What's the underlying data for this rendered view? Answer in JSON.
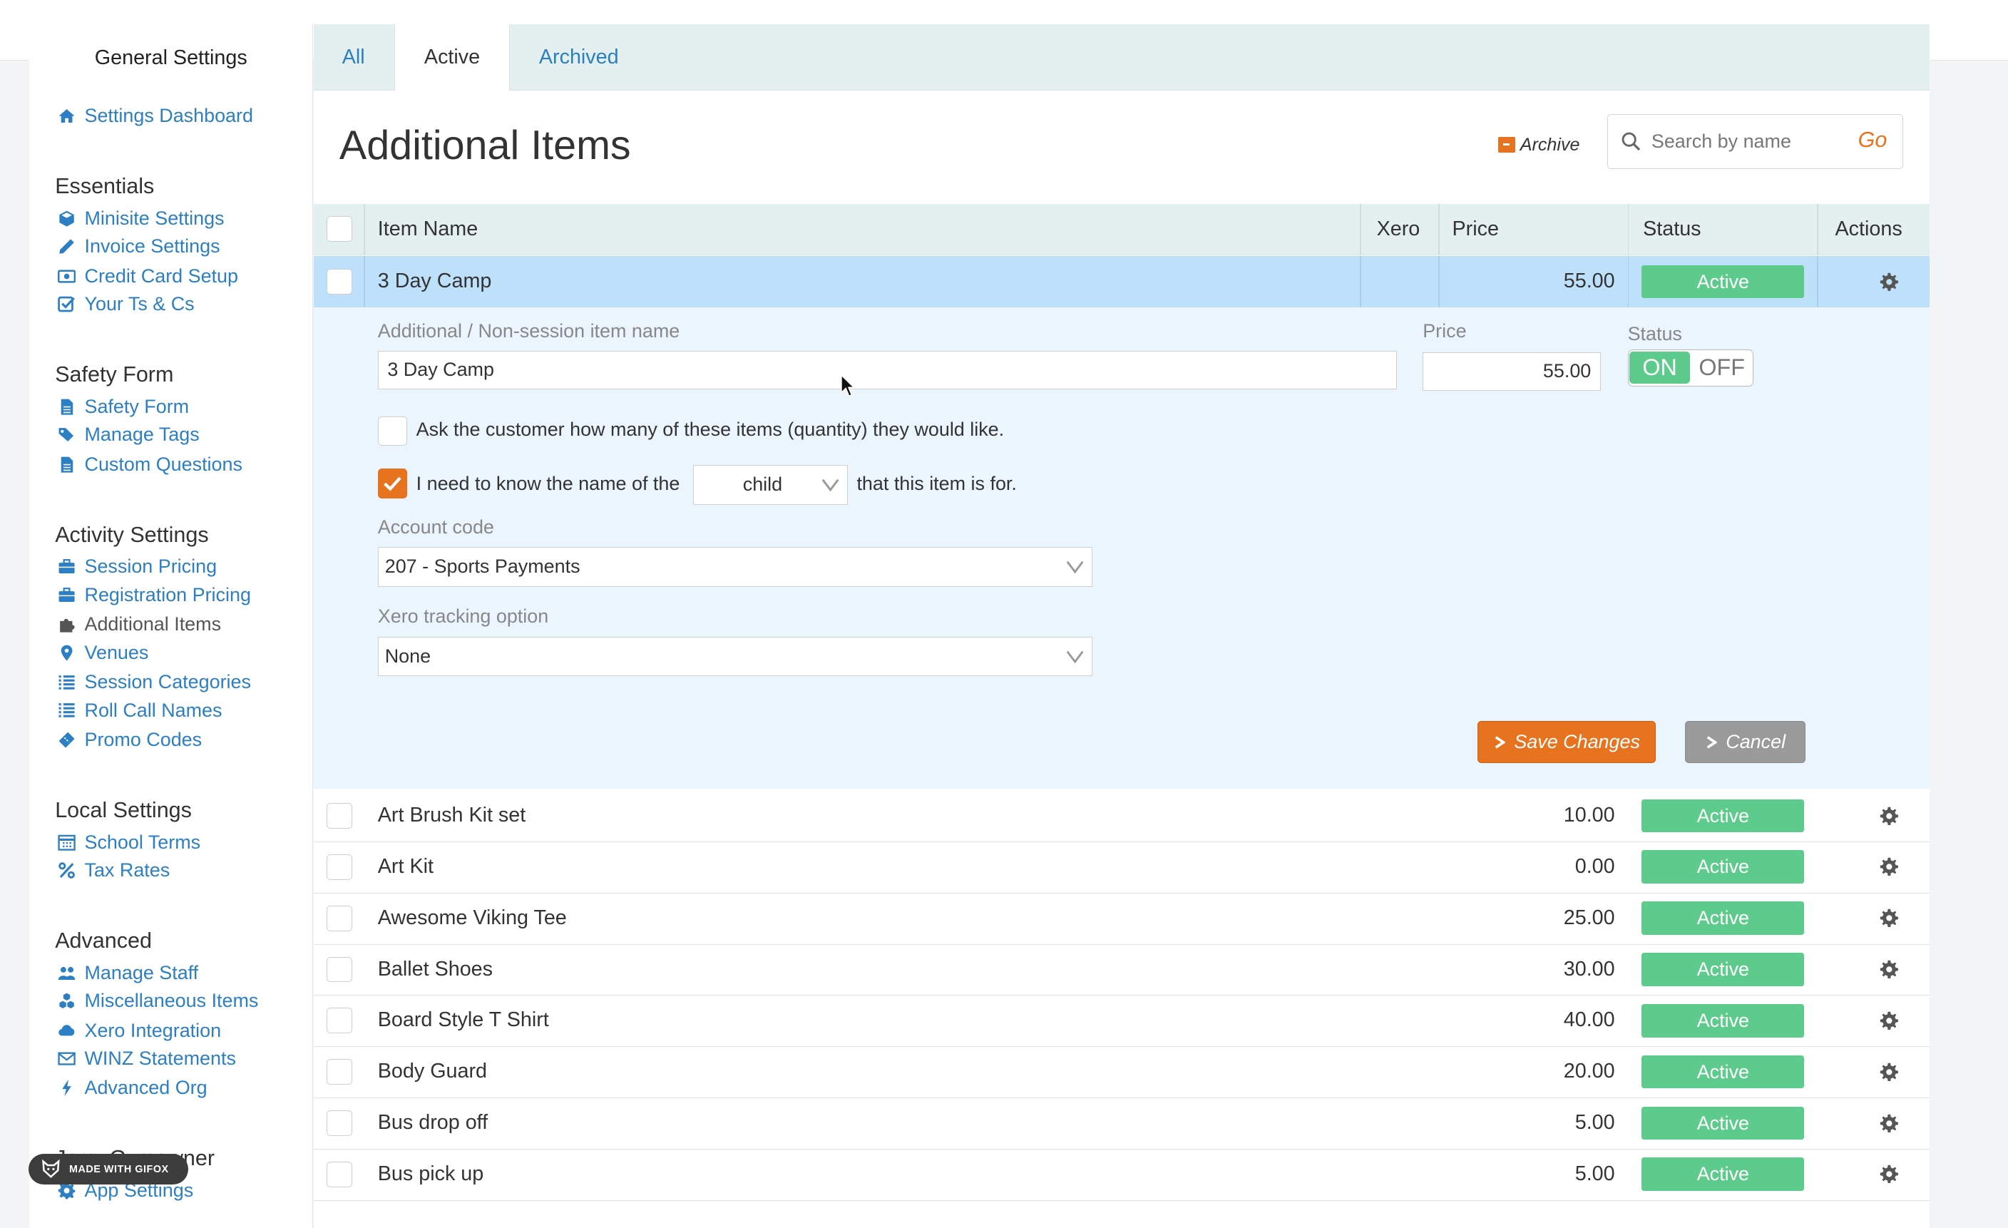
{
  "sidebar": {
    "title": "General Settings",
    "dashboard": {
      "label": "Settings Dashboard",
      "icon": "home-icon"
    },
    "sections": [
      {
        "heading": "Essentials",
        "items": [
          {
            "label": "Minisite Settings",
            "icon": "cube-icon"
          },
          {
            "label": "Invoice Settings",
            "icon": "pencil-icon"
          },
          {
            "label": "Credit Card Setup",
            "icon": "money-icon"
          },
          {
            "label": "Your Ts & Cs",
            "icon": "check-square-icon"
          }
        ]
      },
      {
        "heading": "Safety Form",
        "items": [
          {
            "label": "Safety Form",
            "icon": "file-icon"
          },
          {
            "label": "Manage Tags",
            "icon": "tags-icon"
          },
          {
            "label": "Custom Questions",
            "icon": "file-icon"
          }
        ]
      },
      {
        "heading": "Activity Settings",
        "items": [
          {
            "label": "Session Pricing",
            "icon": "briefcase-icon"
          },
          {
            "label": "Registration Pricing",
            "icon": "briefcase-icon"
          },
          {
            "label": "Additional Items",
            "icon": "puzzle-icon",
            "current": true
          },
          {
            "label": "Venues",
            "icon": "map-marker-icon"
          },
          {
            "label": "Session Categories",
            "icon": "list-icon"
          },
          {
            "label": "Roll Call Names",
            "icon": "list-icon"
          },
          {
            "label": "Promo Codes",
            "icon": "ticket-icon"
          }
        ]
      },
      {
        "heading": "Local Settings",
        "items": [
          {
            "label": "School Terms",
            "icon": "calendar-icon"
          },
          {
            "label": "Tax Rates",
            "icon": "percent-icon"
          }
        ]
      },
      {
        "heading": "Advanced",
        "items": [
          {
            "label": "Manage Staff",
            "icon": "users-icon"
          },
          {
            "label": "Miscellaneous Items",
            "icon": "cubes-icon"
          },
          {
            "label": "Xero Integration",
            "icon": "cloud-icon"
          },
          {
            "label": "WINZ Statements",
            "icon": "envelope-icon"
          },
          {
            "label": "Advanced Org",
            "icon": "bolt-icon"
          }
        ]
      }
    ],
    "user_section": {
      "heading": "Jerry Gymowner",
      "item": {
        "label": "App Settings",
        "icon": "gear-icon"
      }
    }
  },
  "tabs": [
    {
      "label": "All",
      "active": false
    },
    {
      "label": "Active",
      "active": true
    },
    {
      "label": "Archived",
      "active": false
    }
  ],
  "page": {
    "title": "Additional Items",
    "archive_label": "Archive",
    "search": {
      "placeholder": "Search by name",
      "value": "",
      "go_label": "Go"
    }
  },
  "table": {
    "headers": {
      "name": "Item Name",
      "xero": "Xero",
      "price": "Price",
      "status": "Status",
      "actions": "Actions"
    },
    "selected_row": {
      "name": "3 Day Camp",
      "price": "55.00",
      "status": "Active"
    },
    "rows": [
      {
        "name": "Art Brush Kit set",
        "price": "10.00",
        "status": "Active"
      },
      {
        "name": "Art Kit",
        "price": "0.00",
        "status": "Active"
      },
      {
        "name": "Awesome Viking Tee",
        "price": "25.00",
        "status": "Active"
      },
      {
        "name": "Ballet Shoes",
        "price": "30.00",
        "status": "Active"
      },
      {
        "name": "Board Style T Shirt",
        "price": "40.00",
        "status": "Active"
      },
      {
        "name": "Body Guard",
        "price": "20.00",
        "status": "Active"
      },
      {
        "name": "Bus drop off",
        "price": "5.00",
        "status": "Active"
      },
      {
        "name": "Bus pick up",
        "price": "5.00",
        "status": "Active"
      }
    ]
  },
  "edit": {
    "name_label": "Additional / Non-session item name",
    "name_value": "3 Day Camp",
    "price_label": "Price",
    "price_value": "55.00",
    "status_label": "Status",
    "toggle_on": "ON",
    "toggle_off": "OFF",
    "quantity_text": "Ask the customer how many of these items (quantity) they would like.",
    "quantity_checked": false,
    "name_need_prefix": "I need to know the name of the",
    "name_need_checked": true,
    "name_need_select": "child",
    "name_need_suffix": "that this item is for.",
    "account_label": "Account code",
    "account_value": "207 - Sports Payments",
    "tracking_label": "Xero tracking option",
    "tracking_value": "None",
    "save_label": "Save Changes",
    "cancel_label": "Cancel"
  },
  "watermark": "MADE WITH GIFOX",
  "colors": {
    "accent": "#e8731f",
    "link": "#2b7fc2",
    "active_badge": "#5dcb8b",
    "selected_row": "#bde1fb",
    "header_bg": "#e3f0ef"
  }
}
